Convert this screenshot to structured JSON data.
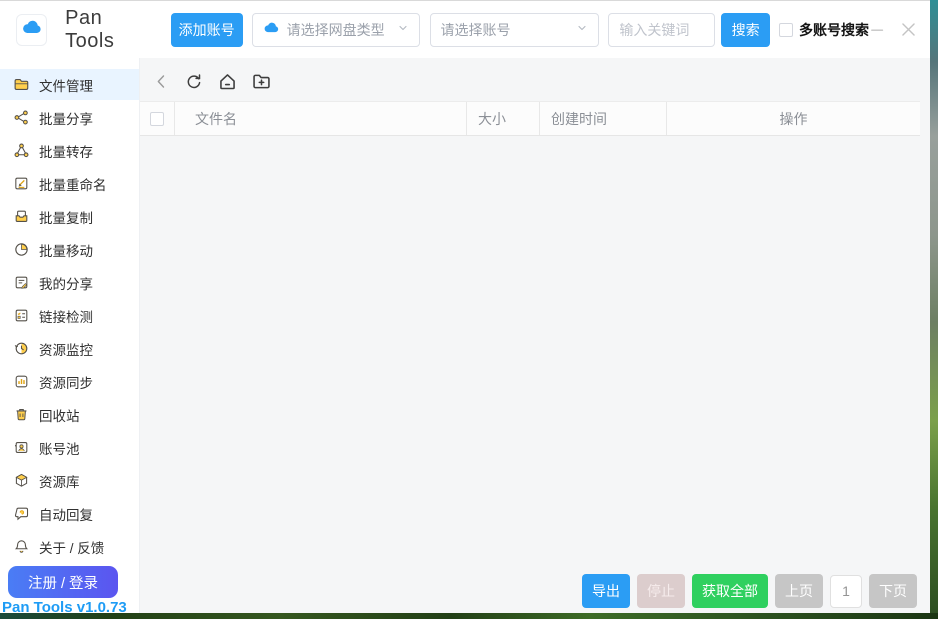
{
  "window": {
    "title": "Pan Tools",
    "version": "Pan Tools v1.0.73"
  },
  "topbar": {
    "add_account": "添加账号",
    "select_type_placeholder": "请选择网盘类型",
    "select_account_placeholder": "请选择账号",
    "keyword_placeholder": "输入关键词",
    "search": "搜索",
    "multi_account_label": "多账号搜索"
  },
  "sidebar": {
    "items": [
      {
        "label": "文件管理",
        "icon": "folder-icon",
        "active": true
      },
      {
        "label": "批量分享",
        "icon": "share-icon",
        "active": false
      },
      {
        "label": "批量转存",
        "icon": "transfer-icon",
        "active": false
      },
      {
        "label": "批量重命名",
        "icon": "rename-icon",
        "active": false
      },
      {
        "label": "批量复制",
        "icon": "copy-icon",
        "active": false
      },
      {
        "label": "批量移动",
        "icon": "move-icon",
        "active": false
      },
      {
        "label": "我的分享",
        "icon": "my-share-icon",
        "active": false
      },
      {
        "label": "链接检测",
        "icon": "link-check-icon",
        "active": false
      },
      {
        "label": "资源监控",
        "icon": "monitor-icon",
        "active": false
      },
      {
        "label": "资源同步",
        "icon": "sync-icon",
        "active": false
      },
      {
        "label": "回收站",
        "icon": "trash-icon",
        "active": false
      },
      {
        "label": "账号池",
        "icon": "account-pool-icon",
        "active": false
      },
      {
        "label": "资源库",
        "icon": "library-icon",
        "active": false
      },
      {
        "label": "自动回复",
        "icon": "auto-reply-icon",
        "active": false
      },
      {
        "label": "关于 / 反馈",
        "icon": "bell-icon",
        "active": false
      }
    ],
    "login_button": "注册 / 登录"
  },
  "table": {
    "columns": [
      "文件名",
      "大小",
      "创建时间",
      "操作"
    ],
    "rows": []
  },
  "footer": {
    "export": "导出",
    "stop": "停止",
    "fetch_all": "获取全部",
    "prev": "上页",
    "page": "1",
    "next": "下页"
  },
  "colors": {
    "accent_blue": "#2b9df4",
    "success_green": "#2fd05f",
    "disabled_pink": "#dccdcd",
    "pager_gray": "#c6c6c6",
    "active_item_bg": "#e9f4ff",
    "icon_gold": "#ffc53d",
    "version_blue": "#1e9cf5"
  }
}
